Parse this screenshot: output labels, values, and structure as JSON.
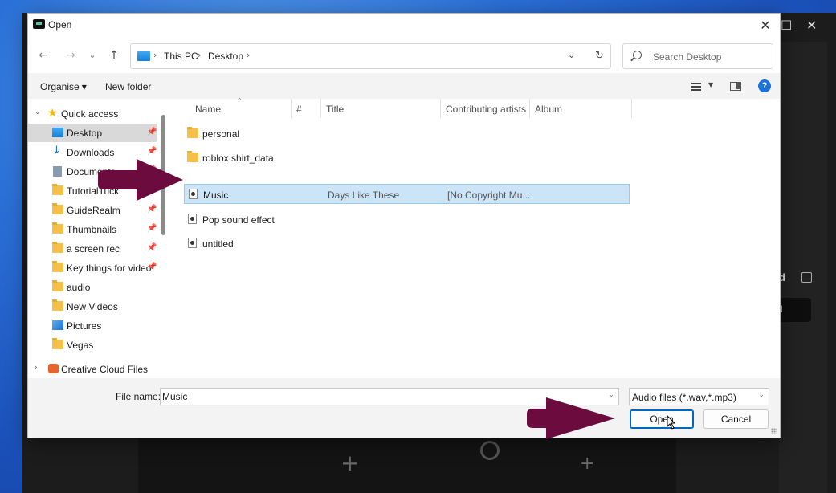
{
  "window": {
    "title": "Open",
    "close_glyph": "✕"
  },
  "navigation": {
    "back_glyph": "←",
    "forward_glyph": "→",
    "recent_glyph": "⌄",
    "up_glyph": "↑",
    "breadcrumbs": [
      "This PC",
      "Desktop"
    ],
    "crumb_separator": "›",
    "dropdown_glyph": "⌄",
    "refresh_glyph": "↻",
    "search_placeholder": "Search Desktop"
  },
  "toolbar": {
    "organise_label": "Organise",
    "new_folder_label": "New folder",
    "help_label": "?"
  },
  "sidebar": {
    "quick_access_label": "Quick access",
    "items": [
      {
        "label": "Desktop",
        "icon": "desktop-icon",
        "pinned": true,
        "selected": true
      },
      {
        "label": "Downloads",
        "icon": "download-icon",
        "pinned": true
      },
      {
        "label": "Documents",
        "icon": "document-icon",
        "pinned": true
      },
      {
        "label": "TutorialTuck",
        "icon": "folder-icon",
        "pinned": true
      },
      {
        "label": "GuideRealm",
        "icon": "folder-icon",
        "pinned": true
      },
      {
        "label": "Thumbnails",
        "icon": "folder-icon",
        "pinned": true
      },
      {
        "label": "a screen rec",
        "icon": "folder-icon",
        "pinned": true
      },
      {
        "label": "Key things for video",
        "icon": "folder-icon",
        "pinned": true
      },
      {
        "label": "audio",
        "icon": "folder-icon",
        "pinned": false
      },
      {
        "label": "New Videos",
        "icon": "folder-icon",
        "pinned": false
      },
      {
        "label": "Pictures",
        "icon": "pictures-icon",
        "pinned": false
      },
      {
        "label": "Vegas",
        "icon": "folder-icon",
        "pinned": false
      }
    ],
    "creative_cloud_label": "Creative Cloud Files"
  },
  "file_list": {
    "columns": [
      "Name",
      "#",
      "Title",
      "Contributing artists",
      "Album"
    ],
    "rows": [
      {
        "name": "personal",
        "type": "folder",
        "title": "",
        "artist": ""
      },
      {
        "name": "roblox shirt_data",
        "type": "folder",
        "title": "",
        "artist": ""
      },
      {
        "name": "Music",
        "type": "audio",
        "title": "Days Like These",
        "artist": "[No Copyright Mu...",
        "selected": true
      },
      {
        "name": "Pop sound effect",
        "type": "audio",
        "title": "",
        "artist": ""
      },
      {
        "name": "untitled",
        "type": "audio",
        "title": "",
        "artist": ""
      }
    ]
  },
  "footer": {
    "file_name_label": "File name:",
    "file_name_value": "Music",
    "file_type_value": "Audio files (*.wav,*.mp3)",
    "open_label": "Open",
    "cancel_label": "Cancel"
  },
  "background_app": {
    "side_text": "d",
    "button_text": "d"
  },
  "colors": {
    "accent": "#0067c0",
    "selection": "#cce4f7",
    "arrow": "#6b0b3e"
  }
}
